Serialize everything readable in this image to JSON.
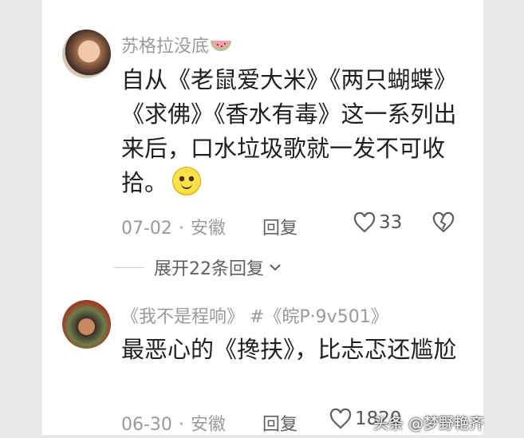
{
  "comments": [
    {
      "username": "苏格拉没底",
      "text": "自从《老鼠爱大米》《两只蝴蝶》《求佛》《香水有毒》这一系列出来后，口水垃圾歌就一发不可收拾。",
      "date": "07-02",
      "location": "安徽",
      "reply_label": "回复",
      "likes": "33"
    },
    {
      "username": "《我不是程响》 #《皖P·9v501》",
      "text": "最恶心的《搀扶》，比忐忑还尴尬",
      "date": "06-30",
      "location": "安徽",
      "reply_label": "回复",
      "likes": "1820"
    }
  ],
  "expand_replies_label": "展开22条回复",
  "separator": "·",
  "watermark": "头条 @梦野艳齐",
  "colors": {
    "muted_text": "#9a9a9a",
    "body_text": "#1f1f1f",
    "side_bg": "#e9e9e9"
  }
}
